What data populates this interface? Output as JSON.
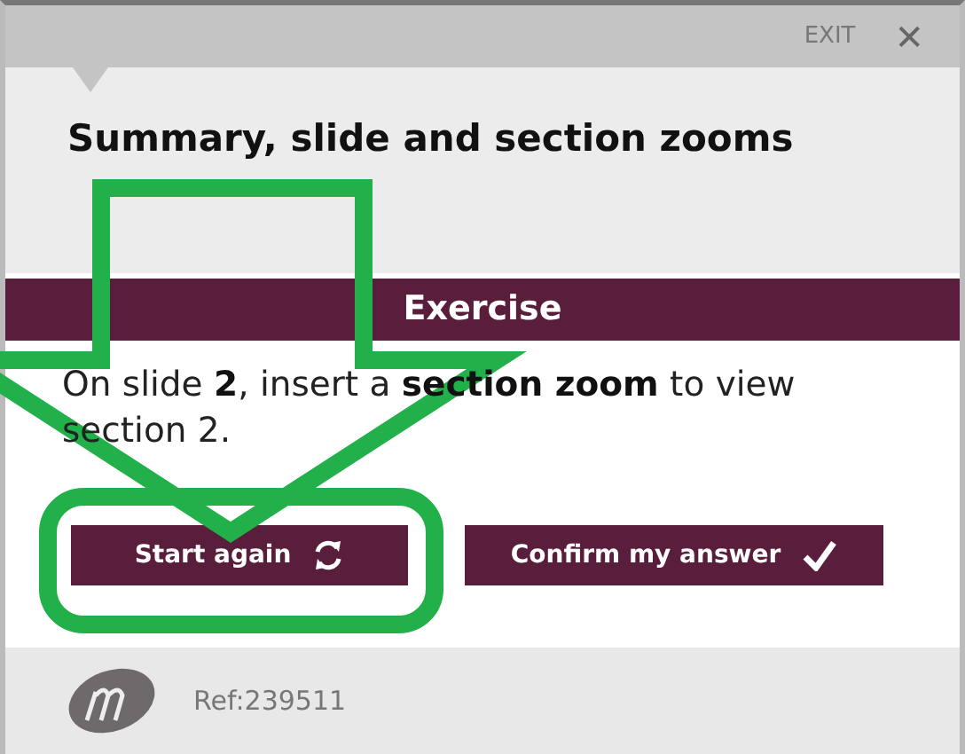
{
  "header": {
    "exit_label": "EXIT",
    "close_glyph": "✕"
  },
  "title": "Summary, slide and section zooms",
  "exercise": {
    "heading": "Exercise",
    "instruction": "On slide **2**, insert a **section zoom** to view section 2."
  },
  "buttons": [
    {
      "label": "Start again",
      "kind": "restart"
    },
    {
      "label": "Confirm my answer",
      "kind": "confirm"
    }
  ],
  "footer": {
    "ref": "Ref:239511"
  }
}
